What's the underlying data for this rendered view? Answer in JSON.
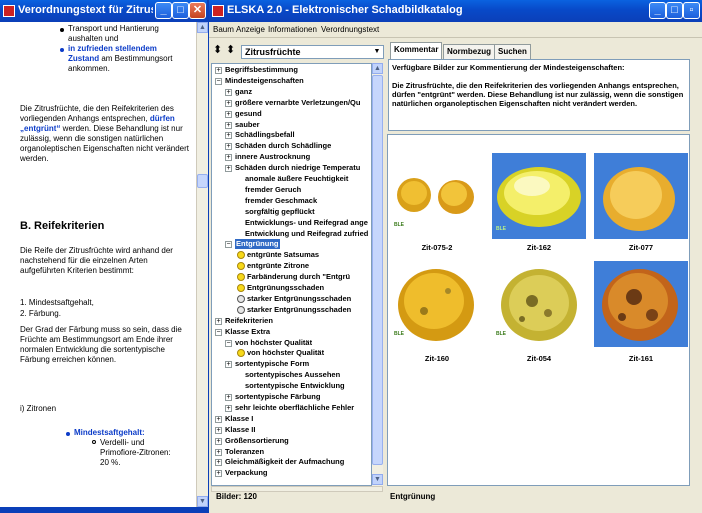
{
  "doc_window": {
    "title": "Verordnungstext für Zitrusf...",
    "bullets_top": [
      {
        "text": "Transport und Hantierung aushalten und",
        "highlight": ""
      },
      {
        "text": "",
        "highlight": "in zufrieden stellendem Zustand",
        "rest": "am Bestimmungsort ankommen."
      }
    ],
    "para1_a": "Die Zitrusfrüchte, die den Reifekriterien des vorliegenden Anhangs entsprechen,",
    "para1_hl": "dürfen „entgrünt“",
    "para1_b": "werden. Diese Behandlung ist nur zulässig, wenn die sonstigen natürlichen organoleptischen Eigenschaften nicht verändert werden.",
    "heading": "B. Reifekriterien",
    "para2": "Die Reife der Zitrusfrüchte wird anhand der nachstehend für die einzelnen Arten aufgeführten Kriterien bestimmt:",
    "list1": "1. Mindestsaftgehalt,",
    "list2": "2. Färbung.",
    "para3": "Der Grad der Färbung muss so sein, dass die Früchte am Bestimmungsort am Ende ihrer normalen Entwicklung die sortentypische Färbung erreichen können.",
    "sub": "i) Zitronen",
    "bullet_bottom": "Mindestsaftgehalt:",
    "subbullet": "Verdelli- und Primofiore-Zitronen: 20 %."
  },
  "main_window": {
    "title": "ELSKA 2.0 - Elektronischer Schadbildkatalog",
    "menu": [
      "Baum",
      "Anzeige",
      "Informationen",
      "Verordnungstext"
    ],
    "combo_value": "Zitrusfrüchte",
    "tabs": [
      "Kommentar",
      "Normbezug",
      "Suchen"
    ],
    "comment_title": "Verfügbare Bilder zur Kommentierung der Mindesteigenschaften:",
    "comment_text": "Die Zitrusfrüchte, die den Reifekriterien des vorliegenden Anhangs entsprechen, dürfen \"entgrünt\" werden. Diese Behandlung ist nur zulässig, wenn die sonstigen natürlichen organoleptischen Eigenschaften nicht verändert werden.",
    "tree": [
      {
        "label": "Begriffsbestimmung",
        "box": "+",
        "icon": ""
      },
      {
        "label": "Mindesteigenschaften",
        "box": "-",
        "icon": ""
      },
      {
        "label": "ganz",
        "box": "+",
        "icon": ""
      },
      {
        "label": "größere vernarbte Verletzungen/Qu",
        "box": "+",
        "icon": ""
      },
      {
        "label": "gesund",
        "box": "+",
        "icon": ""
      },
      {
        "label": "sauber",
        "box": "+",
        "icon": ""
      },
      {
        "label": "Schädlingsbefall",
        "box": "+",
        "icon": ""
      },
      {
        "label": "Schäden durch Schädlinge",
        "box": "+",
        "icon": ""
      },
      {
        "label": "innere Austrocknung",
        "box": "+",
        "icon": ""
      },
      {
        "label": "Schäden durch niedrige Temperatu",
        "box": "+",
        "icon": ""
      },
      {
        "label": "anomale äußere Feuchtigkeit",
        "box": "",
        "icon": ""
      },
      {
        "label": "fremder Geruch",
        "box": "",
        "icon": ""
      },
      {
        "label": "fremder Geschmack",
        "box": "",
        "icon": ""
      },
      {
        "label": "sorgfältig gepflückt",
        "box": "",
        "icon": ""
      },
      {
        "label": "Entwicklungs- und Reifegrad ange",
        "box": "",
        "icon": ""
      },
      {
        "label": "Entwicklung und Reifegrad zufried",
        "box": "",
        "icon": ""
      },
      {
        "label": "Entgrünung",
        "box": "-",
        "icon": ""
      },
      {
        "label": "entgrünte Satsumas",
        "box": "",
        "icon": "yellow"
      },
      {
        "label": "entgrünte Zitrone",
        "box": "",
        "icon": "yellow"
      },
      {
        "label": "Farbänderung durch \"Entgrü",
        "box": "",
        "icon": "yellow"
      },
      {
        "label": "Entgrünungsschaden",
        "box": "",
        "icon": "yellow"
      },
      {
        "label": "starker Entgrünungsschaden",
        "box": "",
        "icon": "grey"
      },
      {
        "label": "starker Entgrünungsschaden",
        "box": "",
        "icon": "grey"
      },
      {
        "label": "Reifekriterien",
        "box": "+",
        "icon": ""
      },
      {
        "label": "Klasse Extra",
        "box": "-",
        "icon": ""
      },
      {
        "label": "von höchster Qualität",
        "box": "-",
        "icon": ""
      },
      {
        "label": "von höchster Qualität",
        "box": "",
        "icon": "yellow"
      },
      {
        "label": "sortentypische Form",
        "box": "+",
        "icon": ""
      },
      {
        "label": "sortentypisches Aussehen",
        "box": "",
        "icon": ""
      },
      {
        "label": "sortentypische Entwicklung",
        "box": "",
        "icon": ""
      },
      {
        "label": "sortentypische Färbung",
        "box": "+",
        "icon": ""
      },
      {
        "label": "sehr leichte oberflächliche Fehler",
        "box": "+",
        "icon": ""
      },
      {
        "label": "Klasse I",
        "box": "+",
        "icon": ""
      },
      {
        "label": "Klasse II",
        "box": "+",
        "icon": ""
      },
      {
        "label": "Größensortierung",
        "box": "+",
        "icon": ""
      },
      {
        "label": "Toleranzen",
        "box": "+",
        "icon": ""
      },
      {
        "label": "Gleichmäßigkeit der Aufmachung",
        "box": "+",
        "icon": ""
      },
      {
        "label": "Verpackung",
        "box": "+",
        "icon": ""
      }
    ],
    "images": [
      "Zit-075-2",
      "Zit-162",
      "Zit-077",
      "Zit-160",
      "Zit-054",
      "Zit-161"
    ],
    "thumb_logo": "BLE",
    "status_left": "Bilder: 120",
    "status_right": "Entgrünung"
  }
}
